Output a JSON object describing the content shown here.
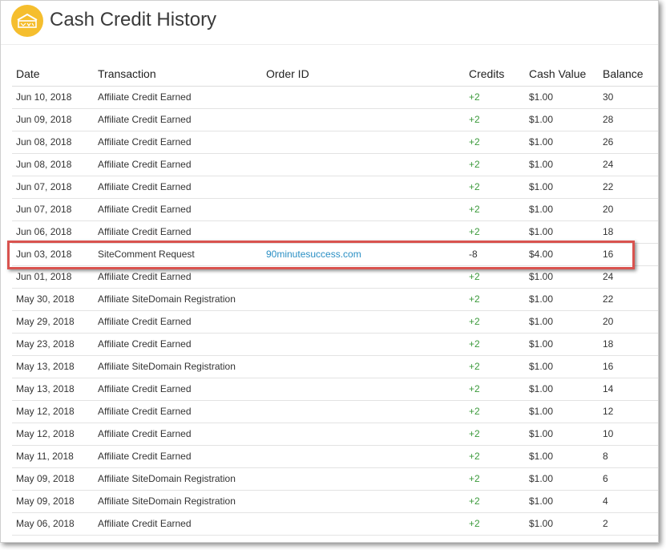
{
  "page": {
    "title": "Cash Credit History"
  },
  "colors": {
    "brand": "#f5be2e",
    "credit_positive": "#3b9a3b",
    "link": "#2a8fc4",
    "highlight_border": "#d9534f"
  },
  "table": {
    "headers": {
      "date": "Date",
      "transaction": "Transaction",
      "order_id": "Order ID",
      "credits": "Credits",
      "cash_value": "Cash Value",
      "balance": "Balance"
    },
    "rows": [
      {
        "date": "Jun 10, 2018",
        "transaction": "Affiliate Credit Earned",
        "order_id": "",
        "credits": "+2",
        "cash_value": "$1.00",
        "balance": "30"
      },
      {
        "date": "Jun 09, 2018",
        "transaction": "Affiliate Credit Earned",
        "order_id": "",
        "credits": "+2",
        "cash_value": "$1.00",
        "balance": "28"
      },
      {
        "date": "Jun 08, 2018",
        "transaction": "Affiliate Credit Earned",
        "order_id": "",
        "credits": "+2",
        "cash_value": "$1.00",
        "balance": "26"
      },
      {
        "date": "Jun 08, 2018",
        "transaction": "Affiliate Credit Earned",
        "order_id": "",
        "credits": "+2",
        "cash_value": "$1.00",
        "balance": "24"
      },
      {
        "date": "Jun 07, 2018",
        "transaction": "Affiliate Credit Earned",
        "order_id": "",
        "credits": "+2",
        "cash_value": "$1.00",
        "balance": "22"
      },
      {
        "date": "Jun 07, 2018",
        "transaction": "Affiliate Credit Earned",
        "order_id": "",
        "credits": "+2",
        "cash_value": "$1.00",
        "balance": "20"
      },
      {
        "date": "Jun 06, 2018",
        "transaction": "Affiliate Credit Earned",
        "order_id": "",
        "credits": "+2",
        "cash_value": "$1.00",
        "balance": "18"
      },
      {
        "date": "Jun 03, 2018",
        "transaction": "SiteComment Request",
        "order_id": "90minutesuccess.com",
        "credits": "-8",
        "cash_value": "$4.00",
        "balance": "16"
      },
      {
        "date": "Jun 01, 2018",
        "transaction": "Affiliate Credit Earned",
        "order_id": "",
        "credits": "+2",
        "cash_value": "$1.00",
        "balance": "24"
      },
      {
        "date": "May 30, 2018",
        "transaction": "Affiliate SiteDomain Registration",
        "order_id": "",
        "credits": "+2",
        "cash_value": "$1.00",
        "balance": "22"
      },
      {
        "date": "May 29, 2018",
        "transaction": "Affiliate Credit Earned",
        "order_id": "",
        "credits": "+2",
        "cash_value": "$1.00",
        "balance": "20"
      },
      {
        "date": "May 23, 2018",
        "transaction": "Affiliate Credit Earned",
        "order_id": "",
        "credits": "+2",
        "cash_value": "$1.00",
        "balance": "18"
      },
      {
        "date": "May 13, 2018",
        "transaction": "Affiliate SiteDomain Registration",
        "order_id": "",
        "credits": "+2",
        "cash_value": "$1.00",
        "balance": "16"
      },
      {
        "date": "May 13, 2018",
        "transaction": "Affiliate Credit Earned",
        "order_id": "",
        "credits": "+2",
        "cash_value": "$1.00",
        "balance": "14"
      },
      {
        "date": "May 12, 2018",
        "transaction": "Affiliate Credit Earned",
        "order_id": "",
        "credits": "+2",
        "cash_value": "$1.00",
        "balance": "12"
      },
      {
        "date": "May 12, 2018",
        "transaction": "Affiliate Credit Earned",
        "order_id": "",
        "credits": "+2",
        "cash_value": "$1.00",
        "balance": "10"
      },
      {
        "date": "May 11, 2018",
        "transaction": "Affiliate Credit Earned",
        "order_id": "",
        "credits": "+2",
        "cash_value": "$1.00",
        "balance": "8"
      },
      {
        "date": "May 09, 2018",
        "transaction": "Affiliate SiteDomain Registration",
        "order_id": "",
        "credits": "+2",
        "cash_value": "$1.00",
        "balance": "6"
      },
      {
        "date": "May 09, 2018",
        "transaction": "Affiliate SiteDomain Registration",
        "order_id": "",
        "credits": "+2",
        "cash_value": "$1.00",
        "balance": "4"
      },
      {
        "date": "May 06, 2018",
        "transaction": "Affiliate Credit Earned",
        "order_id": "",
        "credits": "+2",
        "cash_value": "$1.00",
        "balance": "2"
      }
    ]
  }
}
